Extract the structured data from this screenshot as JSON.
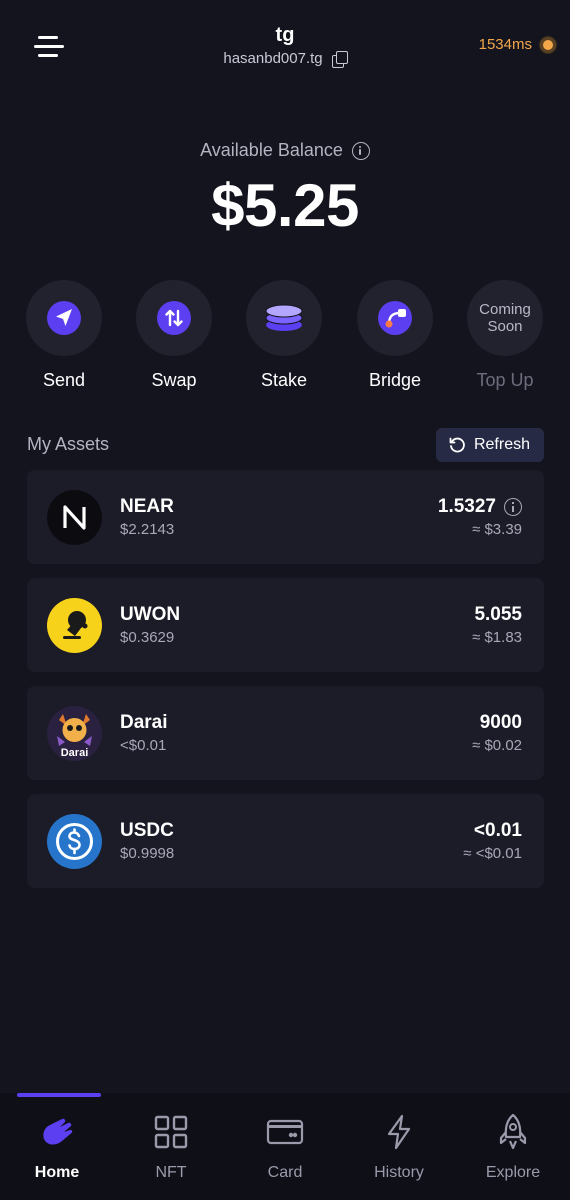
{
  "header": {
    "account_name": "tg",
    "account_id": "hasanbd007.tg",
    "latency": "1534ms"
  },
  "balance": {
    "label": "Available Balance",
    "value": "$5.25"
  },
  "actions": [
    {
      "label": "Send",
      "icon": "send-icon"
    },
    {
      "label": "Swap",
      "icon": "swap-icon"
    },
    {
      "label": "Stake",
      "icon": "stake-icon"
    },
    {
      "label": "Bridge",
      "icon": "bridge-icon"
    },
    {
      "label": "Top Up",
      "badge": "Coming Soon",
      "disabled": true
    }
  ],
  "assets": {
    "title": "My Assets",
    "refresh_label": "Refresh",
    "items": [
      {
        "name": "NEAR",
        "price": "$2.2143",
        "amount": "1.5327",
        "value": "≈ $3.39",
        "has_info": true
      },
      {
        "name": "UWON",
        "price": "$0.3629",
        "amount": "5.055",
        "value": "≈ $1.83"
      },
      {
        "name": "Darai",
        "price": "<$0.01",
        "amount": "9000",
        "value": "≈ $0.02",
        "logo_text": "Darai"
      },
      {
        "name": "USDC",
        "price": "$0.9998",
        "amount": "<0.01",
        "value": "≈ <$0.01"
      }
    ]
  },
  "nav": {
    "items": [
      {
        "label": "Home",
        "icon": "home-hand-icon",
        "active": true
      },
      {
        "label": "NFT",
        "icon": "grid-icon"
      },
      {
        "label": "Card",
        "icon": "card-icon"
      },
      {
        "label": "History",
        "icon": "lightning-icon"
      },
      {
        "label": "Explore",
        "icon": "rocket-icon"
      }
    ]
  },
  "colors": {
    "background": "#14141f",
    "card": "#1c1c29",
    "accent": "#5b3ff0",
    "latency": "#f3a64a",
    "refresh_bg": "#272a45"
  }
}
